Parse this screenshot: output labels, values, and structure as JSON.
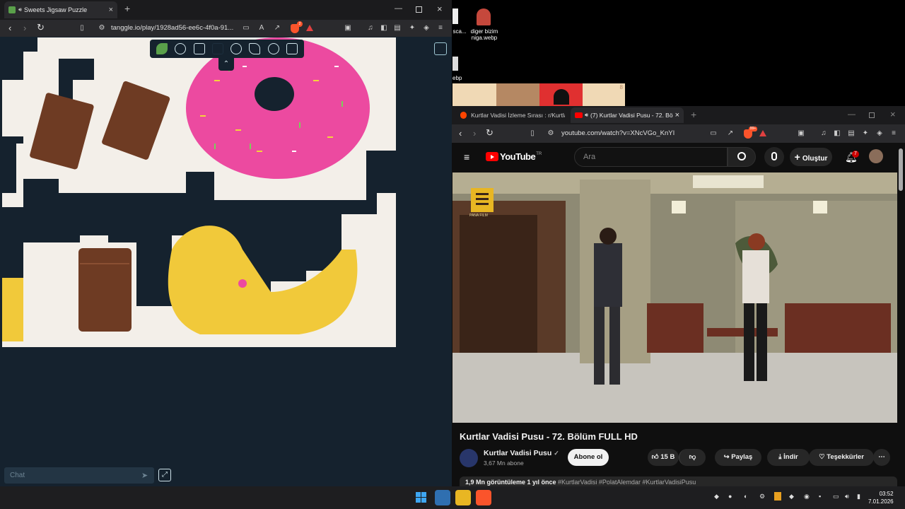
{
  "left_browser": {
    "tab_title": "Sweets Jigsaw Puzzle",
    "url": "tanggle.io/play/1928ad56-ee6c-4f0a-91...",
    "brave_badge": "2",
    "chat_placeholder": "Chat"
  },
  "desktop": {
    "icon1_label": "diger bizim niga.webp",
    "icon2_label": "sca...",
    "icon3_label": "ebp",
    "chess_number": "8"
  },
  "right_browser": {
    "tab1_title": "Kurtlar Vadisi İzleme Sırası : r/Kurtlar...",
    "tab2_title": "(7) Kurtlar Vadisi Pusu - 72. Bö...",
    "url": "youtube.com/watch?v=XNcVGo_KnYI",
    "brave_badge": "99+"
  },
  "youtube": {
    "logo_text": "YouTube",
    "region": "TR",
    "search_placeholder": "Ara",
    "create_label": "Oluştur",
    "notification_count": "7",
    "video_title": "Kurtlar Vadisi Pusu - 72. Bölüm FULL HD",
    "channel_name": "Kurtlar Vadisi Pusu",
    "subscribers": "3,67 Mn abone",
    "subscribe_label": "Abone ol",
    "likes": "15 B",
    "share_label": "Paylaş",
    "download_label": "İndir",
    "thanks_label": "Teşekkürler",
    "description_stats": "1,9 Mn görüntüleme  1 yıl önce",
    "description_tags": "#KurtlarVadisi #PolatAlemdar #KurtlarVadisiPusu",
    "watermark": "PANA FILM"
  },
  "taskbar": {
    "time": "03:52",
    "date": "7.01.2026"
  },
  "colors": {
    "puzzle_bg": "#15222e",
    "youtube_red": "#ff0000",
    "brave_orange": "#fb542b"
  }
}
